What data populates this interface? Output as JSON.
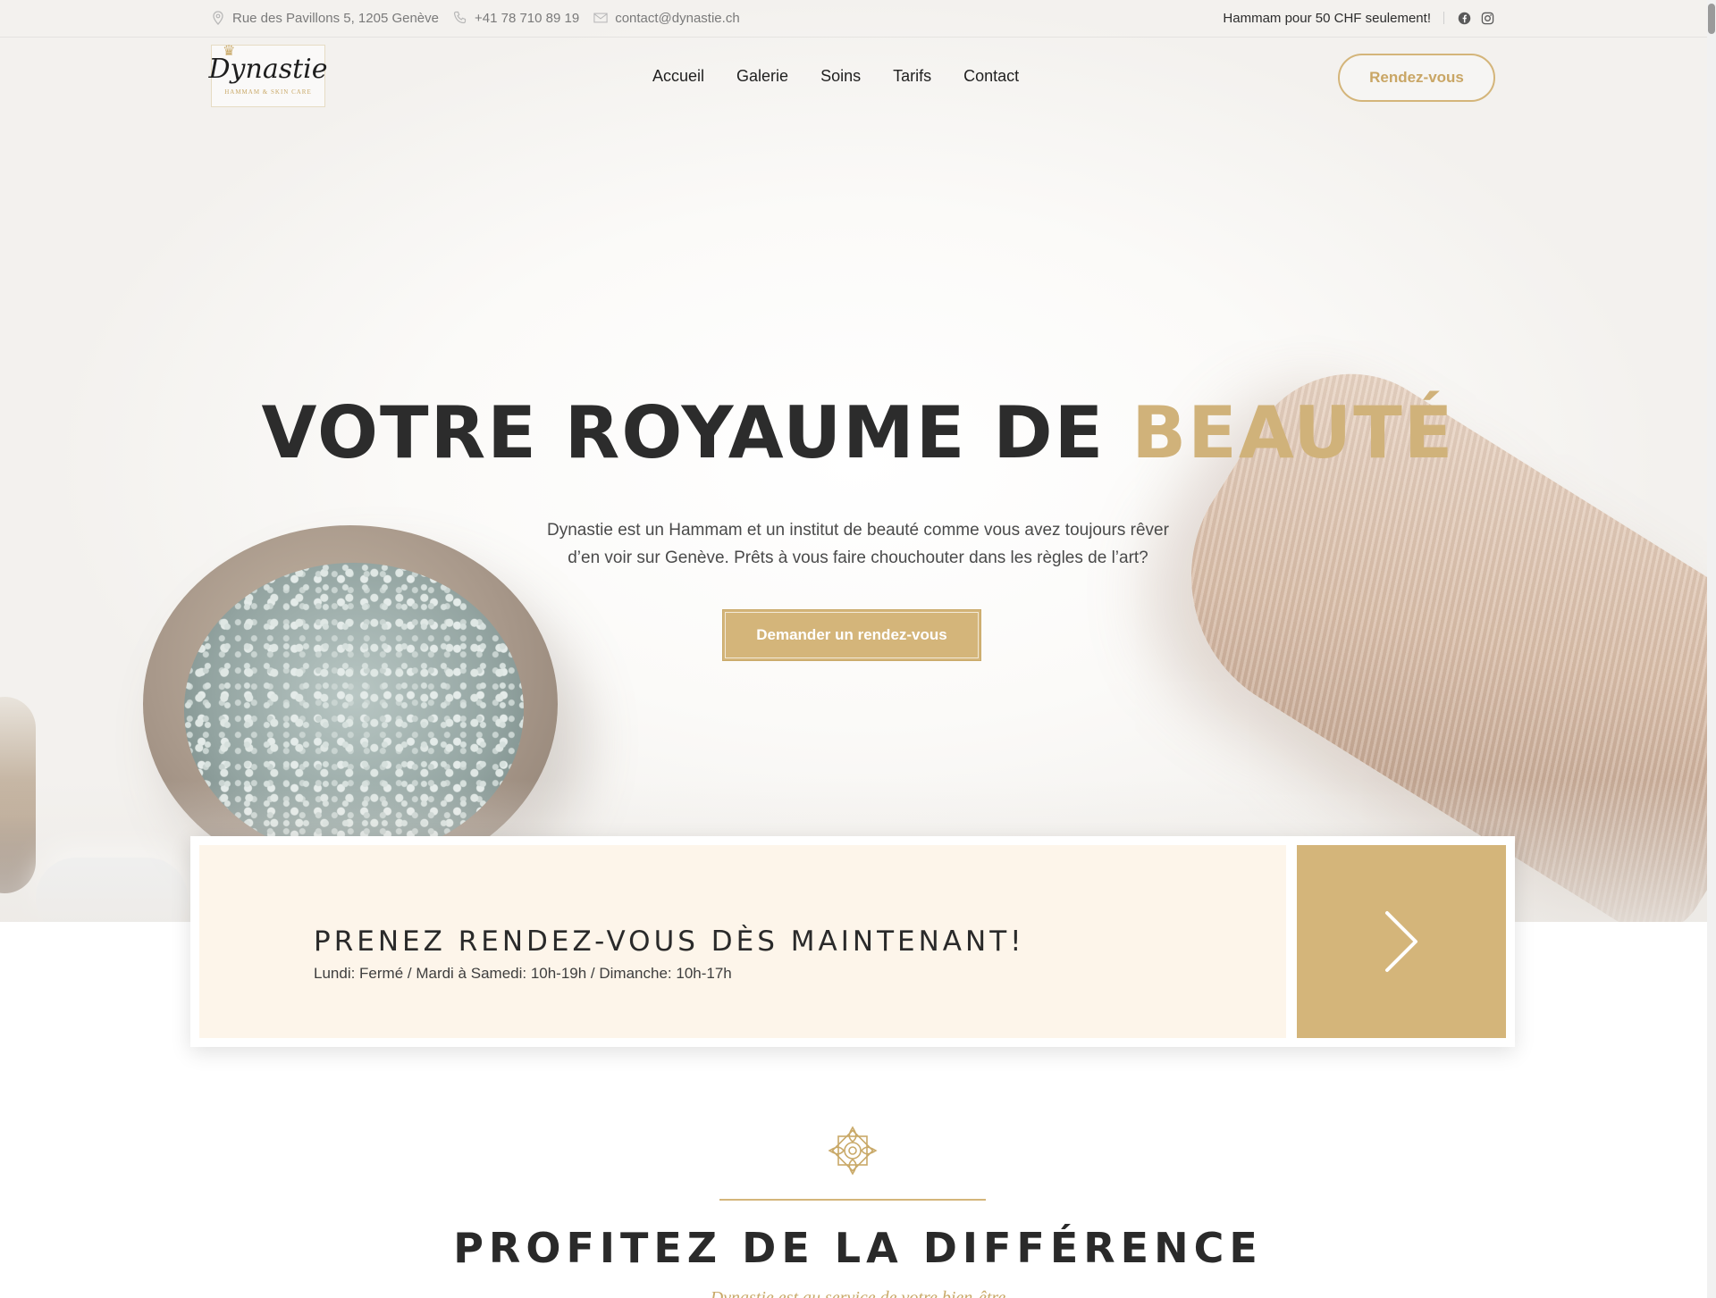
{
  "topbar": {
    "address": "Rue des Pavillons 5, 1205 Genève",
    "phone": "+41 78 710 89 19",
    "email": "contact@dynastie.ch",
    "promo": "Hammam pour 50 CHF seulement!",
    "icons": [
      "location-pin-icon",
      "phone-icon",
      "mail-icon",
      "facebook-icon",
      "instagram-icon"
    ]
  },
  "header": {
    "logo": {
      "name": "Dynastie",
      "subtitle": "HAMMAM & SKIN CARE"
    },
    "nav": [
      "Accueil",
      "Galerie",
      "Soins",
      "Tarifs",
      "Contact"
    ],
    "cta": "Rendez-vous"
  },
  "hero": {
    "title_main": "VOTRE ROYAUME DE ",
    "title_accent": "BEAUTÉ",
    "description_line1": "Dynastie est un Hammam et un institut de beauté comme vous avez toujours rêver",
    "description_line2": "d’en voir sur Genève. Prêts à vous faire chouchouter dans les règles de l’art?",
    "button": "Demander un rendez-vous"
  },
  "appointment": {
    "title": "PRENEZ RENDEZ-VOUS DÈS MAINTENANT!",
    "hours": "Lundi: Fermé / Mardi à Samedi: 10h-19h / Dimanche: 10h-17h",
    "arrow_icon": "chevron-right-icon"
  },
  "section": {
    "title": "PROFITEZ DE LA DIFFÉRENCE",
    "subtitle": "Dynastie est au service de votre bien-être"
  },
  "colors": {
    "gold": "#d4b57a",
    "cream": "#fdf5ea",
    "dark_text": "#2a2a2a"
  }
}
